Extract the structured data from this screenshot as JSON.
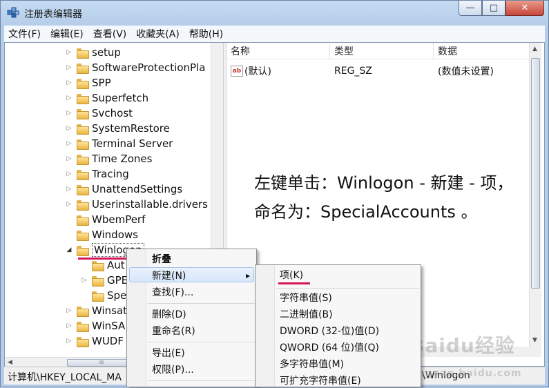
{
  "window": {
    "title": "注册表编辑器",
    "buttons": [
      "—",
      "□",
      "✕"
    ]
  },
  "menubar": [
    "文件(F)",
    "编辑(E)",
    "查看(V)",
    "收藏夹(A)",
    "帮助(H)"
  ],
  "tree": {
    "items": [
      "setup",
      "SoftwareProtectionPla",
      "SPP",
      "Superfetch",
      "Svchost",
      "SystemRestore",
      "Terminal Server",
      "Time Zones",
      "Tracing",
      "UnattendSettings",
      "Userinstallable.drivers",
      "WbemPerf",
      "Windows",
      "Winlogon"
    ],
    "children": [
      "Aut",
      "GPE",
      "Spe"
    ],
    "after": [
      "Winsat",
      "WinSA",
      "WUDF"
    ],
    "hscroll_label": "III"
  },
  "list": {
    "headers": [
      "名称",
      "类型",
      "数据"
    ],
    "row": {
      "name": "(默认)",
      "type": "REG_SZ",
      "data": "(数值未设置)"
    }
  },
  "annotation": {
    "line1": "左键单击：Winlogon - 新建 - 项，",
    "line2": "命名为：SpecialAccounts 。"
  },
  "context_menu": {
    "items": [
      "折叠",
      "新建(N)",
      "查找(F)...",
      "删除(D)",
      "重命名(R)",
      "导出(E)",
      "权限(P)..."
    ]
  },
  "submenu": {
    "items": [
      "项(K)",
      "字符串值(S)",
      "二进制值(B)",
      "DWORD (32-位)值(D)",
      "QWORD (64 位)值(Q)",
      "多字符串值(M)",
      "可扩充字符串值(E)"
    ]
  },
  "status": {
    "path_start": "计算机\\HKEY_LOCAL_MA",
    "path_end": "\\Winlogon"
  },
  "watermark": {
    "main": "Baidu",
    "sub": "经验",
    "small": "jingyan.baidu.com"
  },
  "colors": {
    "accent_underline": "#d5145a",
    "highlight": "#d6e7fb"
  }
}
